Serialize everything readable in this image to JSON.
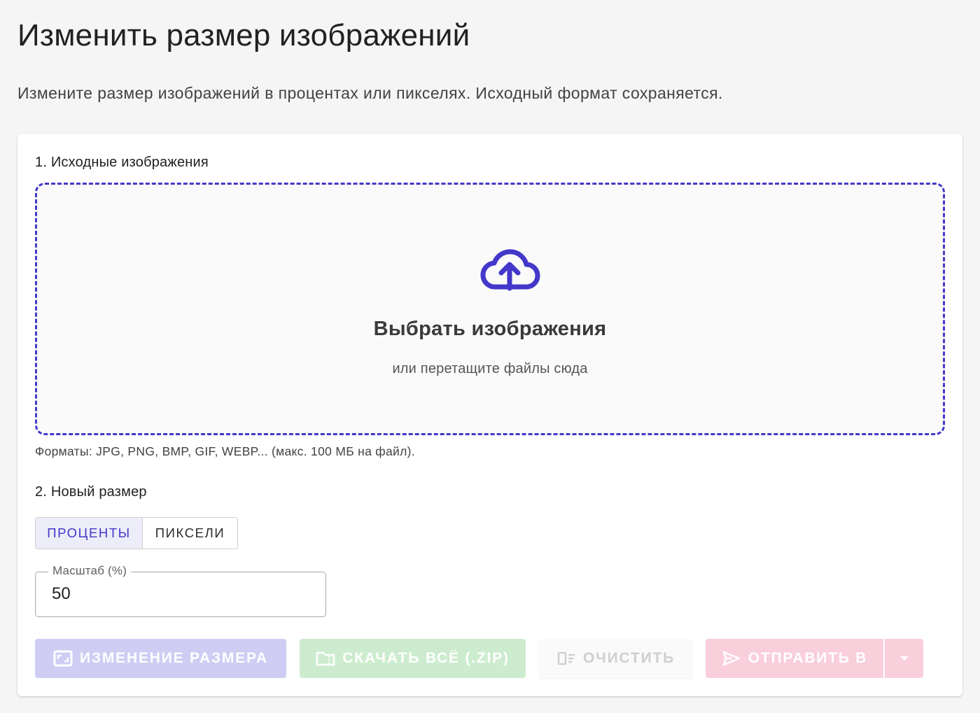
{
  "header": {
    "title": "Изменить размер изображений",
    "subtitle": "Измените размер изображений в процентах или пикселях. Исходный формат сохраняется."
  },
  "source": {
    "section_title": "1. Исходные изображения",
    "dropzone_title": "Выбрать изображения",
    "dropzone_subtitle": "или перетащите файлы сюда",
    "formats_note": "Форматы: JPG, PNG, BMP, GIF, WEBP... (макс. 100 МБ на файл).",
    "icon": "cloud-upload-icon"
  },
  "size": {
    "section_title": "2. Новый размер",
    "modes": [
      {
        "label": "ПРОЦЕНТЫ",
        "active": true
      },
      {
        "label": "ПИКСЕЛИ",
        "active": false
      }
    ],
    "scale_label": "Масштаб (%)",
    "scale_value": "50"
  },
  "actions": {
    "resize_label": "ИЗМЕНЕНИЕ РАЗМЕРА",
    "zip_label": "СКАЧАТЬ ВСЁ (.ZIP)",
    "clear_label": "ОЧИСТИТЬ",
    "send_label": "ОТПРАВИТЬ В",
    "icons": {
      "resize": "aspect-ratio-icon",
      "zip": "folder-zip-icon",
      "clear": "clear-list-icon",
      "send": "send-icon",
      "caret": "caret-down-icon"
    }
  },
  "colors": {
    "accent": "#4338ca",
    "resize_disabled": "#cfcdf3",
    "zip_disabled": "#cdeccf",
    "send_disabled": "#f9cfdc"
  }
}
